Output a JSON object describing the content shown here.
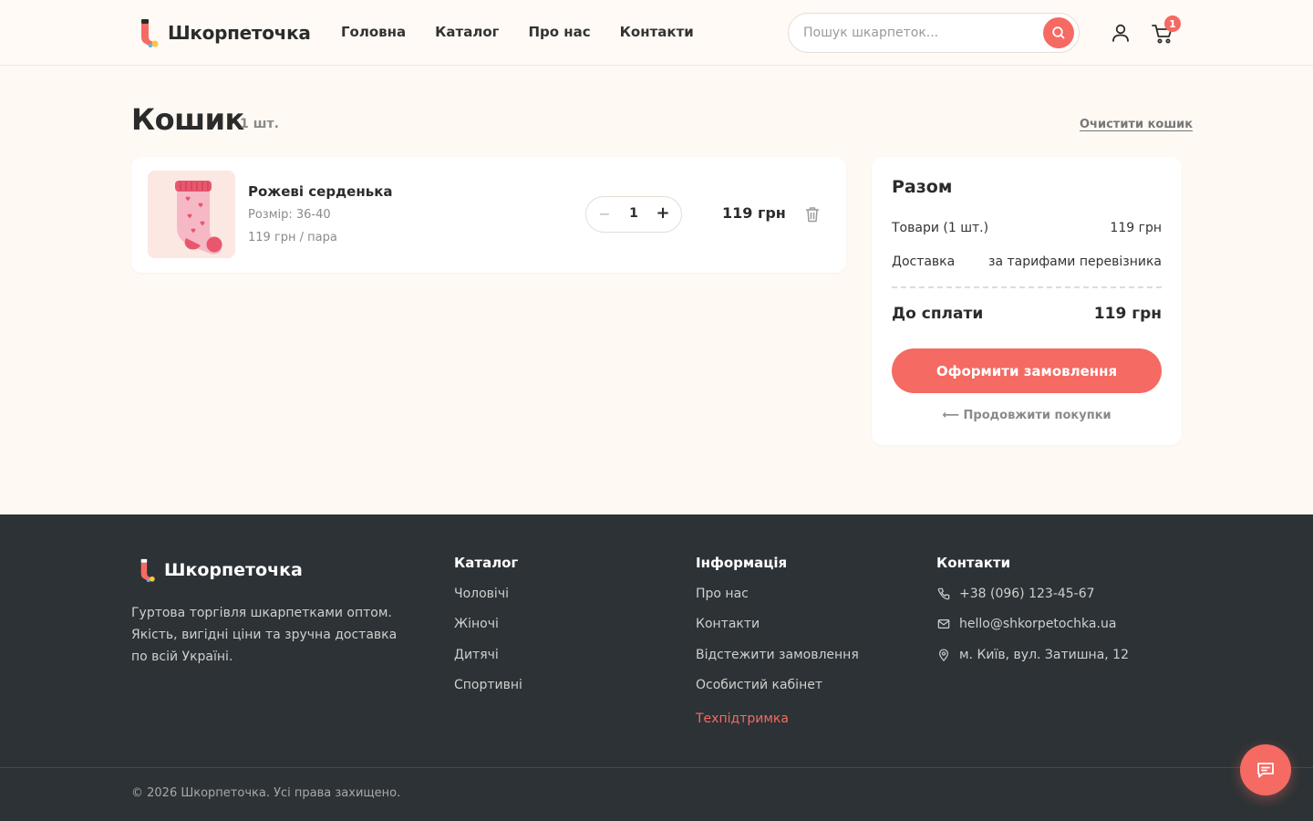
{
  "brand": {
    "name": "Шкорпеточка",
    "accent": "#f56a62"
  },
  "nav": {
    "items": [
      "Головна",
      "Каталог",
      "Про нас",
      "Контакти"
    ]
  },
  "search": {
    "placeholder": "Пошук шкарпеток..."
  },
  "cart_badge": "1",
  "page": {
    "title": "Кошик",
    "count": "1 шт.",
    "clear_label": "Очистити кошик"
  },
  "item": {
    "name": "Рожеві серденька",
    "size": "Розмір: 36-40",
    "unit_price": "119 грн / пара",
    "quantity": "1",
    "minus": "−",
    "plus": "+",
    "total": "119 грн"
  },
  "summary": {
    "title": "Разом",
    "goods_label": "Товари (1 шт.)",
    "goods_value": "119 грн",
    "delivery_label": "Доставка",
    "delivery_value": "за тарифами перевізника",
    "total_label": "До сплати",
    "total_value": "119 грн",
    "checkout_label": "Оформити замовлення",
    "continue_label": "⟵ Продовжити покупки"
  },
  "footer": {
    "description": "Гуртова торгівля шкарпетками оптом. Якість, вигідні ціни та зручна доставка по всій Україні.",
    "catalog": {
      "title": "Каталог",
      "links": [
        "Чоловічі",
        "Жіночі",
        "Дитячі",
        "Спортивні"
      ]
    },
    "info": {
      "title": "Інформація",
      "links": [
        "Про нас",
        "Контакти",
        "Відстежити замовлення",
        "Особистий кабінет"
      ],
      "support": "Техпідтримка"
    },
    "contacts": {
      "title": "Контакти",
      "phone": "+38 (096) 123-45-67",
      "email": "hello@shkorpetochka.ua",
      "address": "м. Київ, вул. Затишна, 12"
    },
    "copyright": "© 2026 Шкорпеточка. Усі права захищено."
  }
}
